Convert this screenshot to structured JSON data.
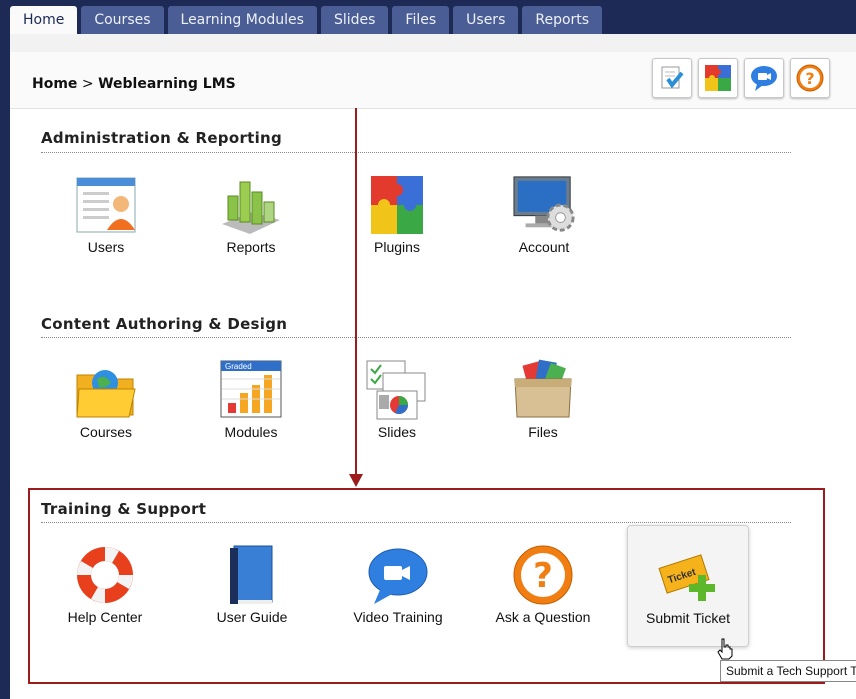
{
  "tabs": [
    {
      "label": "Home",
      "active": true
    },
    {
      "label": "Courses",
      "active": false
    },
    {
      "label": "Learning Modules",
      "active": false
    },
    {
      "label": "Slides",
      "active": false
    },
    {
      "label": "Files",
      "active": false
    },
    {
      "label": "Users",
      "active": false
    },
    {
      "label": "Reports",
      "active": false
    }
  ],
  "breadcrumb": {
    "home": "Home",
    "separator": ">",
    "current": "Weblearning LMS"
  },
  "header_icons": [
    "checklist-icon",
    "puzzle-icon",
    "video-chat-icon",
    "question-icon"
  ],
  "sections": [
    {
      "title": "Administration & Reporting",
      "items": [
        {
          "label": "Users",
          "icon": "users-icon"
        },
        {
          "label": "Reports",
          "icon": "bar-chart-icon"
        },
        {
          "label": "Plugins",
          "icon": "puzzle-icon"
        },
        {
          "label": "Account",
          "icon": "monitor-gear-icon"
        }
      ]
    },
    {
      "title": "Content Authoring & Design",
      "items": [
        {
          "label": "Courses",
          "icon": "globe-folder-icon"
        },
        {
          "label": "Modules",
          "icon": "graded-chart-icon"
        },
        {
          "label": "Slides",
          "icon": "slides-icon"
        },
        {
          "label": "Files",
          "icon": "box-files-icon"
        }
      ]
    },
    {
      "title": "Training & Support",
      "items": [
        {
          "label": "Help Center",
          "icon": "lifebuoy-icon"
        },
        {
          "label": "User Guide",
          "icon": "book-icon"
        },
        {
          "label": "Video Training",
          "icon": "video-bubble-icon"
        },
        {
          "label": "Ask a Question",
          "icon": "question-icon"
        },
        {
          "label": "Submit Ticket",
          "icon": "ticket-icon",
          "hovered": true
        }
      ]
    }
  ],
  "modules_icon_text": "Graded",
  "ticket_icon_text": "Ticket",
  "tooltip": "Submit a Tech Support T",
  "colors": {
    "nav_bg": "#1c2a55",
    "tab_bg": "#4a5d95",
    "highlight": "#9c1b1b"
  }
}
